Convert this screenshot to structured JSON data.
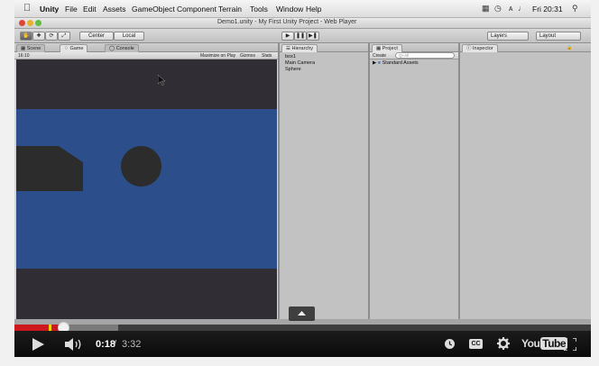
{
  "menubar": {
    "app_name": "Unity",
    "items": [
      "File",
      "Edit",
      "Assets",
      "GameObject",
      "Component",
      "Terrain",
      "Tools",
      "Window",
      "Help"
    ],
    "clock": "Fri 20:31"
  },
  "window": {
    "title": "Demo1.unity - My First Unity Project - Web Player"
  },
  "toolbar": {
    "pivot_label": "Center",
    "space_label": "Local",
    "layers_label": "Layers",
    "layout_label": "Layout"
  },
  "scene_panel": {
    "tabs": [
      "Scene",
      "Game",
      "Console"
    ],
    "aspect_label": "16:10",
    "options": [
      "Maximize on Play",
      "Gizmos",
      "Stats"
    ]
  },
  "hierarchy": {
    "tab": "Hierarchy",
    "items": [
      "box1",
      "Main Camera",
      "Sphere"
    ]
  },
  "project": {
    "tab": "Project",
    "create_label": "Create",
    "search_placeholder": "Q+All",
    "items": [
      "Standard Assets"
    ]
  },
  "inspector": {
    "tab": "Inspector"
  },
  "player": {
    "current_time": "0:18",
    "separator": "/",
    "duration": "3:32",
    "progress_fraction": 0.085,
    "buffered_fraction": 0.18,
    "logo_you": "You",
    "logo_tube": "Tube",
    "cc_label": "CC",
    "colors": {
      "played": "#cc181e",
      "ad_marker": "#f1d700",
      "scene_blue": "#2c4f8c"
    }
  }
}
